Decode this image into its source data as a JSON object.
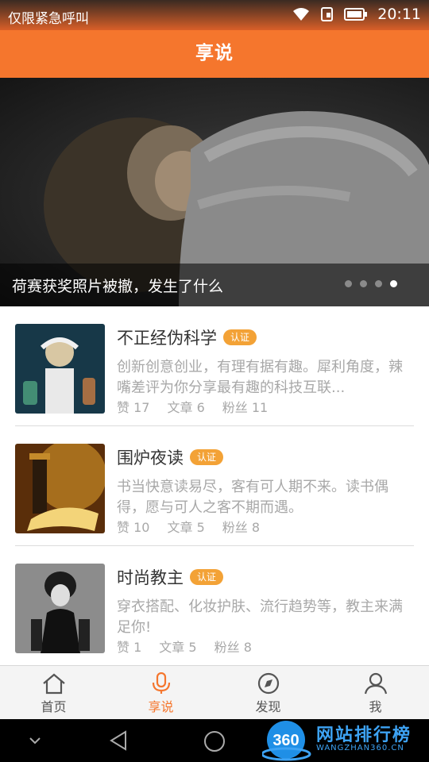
{
  "status_bar": {
    "carrier": "仅限紧急呼叫",
    "time": "20:11",
    "icons": [
      "wifi-icon",
      "sim-icon",
      "battery-icon"
    ]
  },
  "app_bar": {
    "title": "享说"
  },
  "banner": {
    "caption": "荷赛获奖照片被撤，发生了什么",
    "page_count": 4,
    "active_page": 4
  },
  "channels": [
    {
      "name": "不正经伪科学",
      "badge": "认证",
      "description": "创新创意创业，有理有据有趣。犀利角度，辣嘴差评为你分享最有趣的科技互联...",
      "likes_label": "赞",
      "likes": "17",
      "articles_label": "文章",
      "articles": "6",
      "fans_label": "粉丝",
      "fans": "11"
    },
    {
      "name": "围炉夜读",
      "badge": "认证",
      "description": "书当快意读易尽，客有可人期不来。读书偶得，愿与可人之客不期而遇。",
      "likes_label": "赞",
      "likes": "10",
      "articles_label": "文章",
      "articles": "5",
      "fans_label": "粉丝",
      "fans": "8"
    },
    {
      "name": "时尚教主",
      "badge": "认证",
      "description": "穿衣搭配、化妆护肤、流行趋势等，教主来满足你!",
      "likes_label": "赞",
      "likes": "1",
      "articles_label": "文章",
      "articles": "5",
      "fans_label": "粉丝",
      "fans": "8"
    }
  ],
  "tabs": [
    {
      "label": "首页",
      "icon": "home-icon"
    },
    {
      "label": "享说",
      "icon": "microphone-icon",
      "active": true
    },
    {
      "label": "发现",
      "icon": "compass-icon"
    },
    {
      "label": "我",
      "icon": "person-icon"
    }
  ],
  "watermark": {
    "logo": "360",
    "text": "网站排行榜",
    "sub": "WANGZHAN360.CN"
  },
  "colors": {
    "accent": "#f5762d",
    "badge": "#f3a236",
    "muted_text": "#a8a8a8"
  }
}
